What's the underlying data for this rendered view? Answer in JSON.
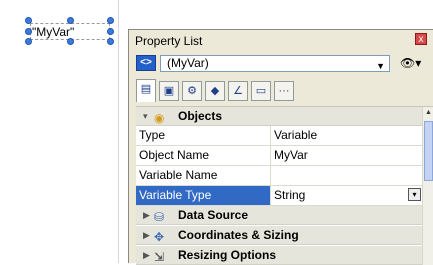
{
  "canvas": {
    "object_text": "\"MyVar\""
  },
  "panel": {
    "title": "Property List",
    "close_glyph": "x",
    "object_selector": {
      "icon_glyph": "<>",
      "value": "(MyVar)"
    },
    "eye_glyph": "👁▾",
    "tabs": [
      {
        "icon": "list-icon",
        "glyph": "▤"
      },
      {
        "icon": "appearance-icon",
        "glyph": "▣"
      },
      {
        "icon": "gear-icon",
        "glyph": "⚙"
      },
      {
        "icon": "shapes-icon",
        "glyph": "◆"
      },
      {
        "icon": "chart-icon",
        "glyph": "∠"
      },
      {
        "icon": "monitor-icon",
        "glyph": "▭"
      },
      {
        "icon": "more-icon",
        "glyph": "···"
      }
    ],
    "categories": {
      "objects": {
        "label": "Objects",
        "toggle": "▾",
        "icon_glyph": "◉"
      },
      "data_source": {
        "label": "Data Source",
        "toggle": "▶",
        "icon_glyph": "⛁"
      },
      "coordinates": {
        "label": "Coordinates & Sizing",
        "toggle": "▶",
        "icon_glyph": "✥"
      },
      "resizing": {
        "label": "Resizing Options",
        "toggle": "▶",
        "icon_glyph": "⇲"
      }
    },
    "rows": [
      {
        "name": "Type",
        "value": "Variable"
      },
      {
        "name": "Object Name",
        "value": "MyVar"
      },
      {
        "name": "Variable Name",
        "value": ""
      },
      {
        "name": "Variable Type",
        "value": "String"
      }
    ],
    "dropdown_glyph": "▾"
  }
}
